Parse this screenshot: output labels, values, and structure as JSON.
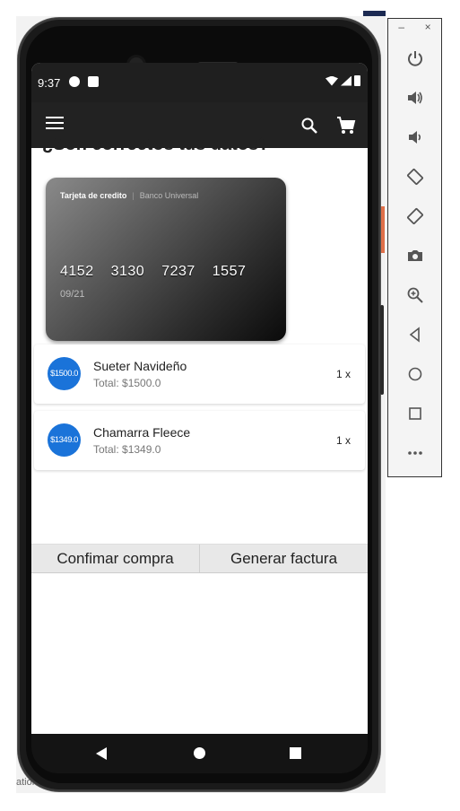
{
  "status_bar": {
    "time": "9:37"
  },
  "app_bar": {
    "menu_icon": "menu-icon",
    "search_icon": "search-icon",
    "cart_icon": "cart-icon"
  },
  "page": {
    "title_peek": "¿Son correctos tus datos?"
  },
  "card": {
    "type": "Tarjeta de credito",
    "separator": "|",
    "bank": "Banco Universal",
    "number_groups": [
      "4152",
      "3130",
      "7237",
      "1557"
    ],
    "expiry": "09/21"
  },
  "items": [
    {
      "badge": "$1500.0",
      "name": "Sueter Navideño",
      "total": "Total: $1500.0",
      "qty": "1 x"
    },
    {
      "badge": "$1349.0",
      "name": " Chamarra Fleece",
      "total": "Total: $1349.0",
      "qty": "1 x"
    }
  ],
  "actions": {
    "confirm": "Confimar compra",
    "invoice": "Generar factura"
  },
  "emulator": {
    "minimize": "–",
    "close": "×",
    "buttons": [
      "power-icon",
      "volume-up-icon",
      "volume-down-icon",
      "rotate-left-icon",
      "rotate-right-icon",
      "camera-icon",
      "zoom-icon",
      "back-icon",
      "home-icon",
      "overview-icon",
      "more-icon"
    ]
  },
  "background": {
    "bottom_text": "ation"
  },
  "colors": {
    "badge": "#1a73d9",
    "app_bar": "#222222",
    "status_bar": "#1f1f1f"
  }
}
